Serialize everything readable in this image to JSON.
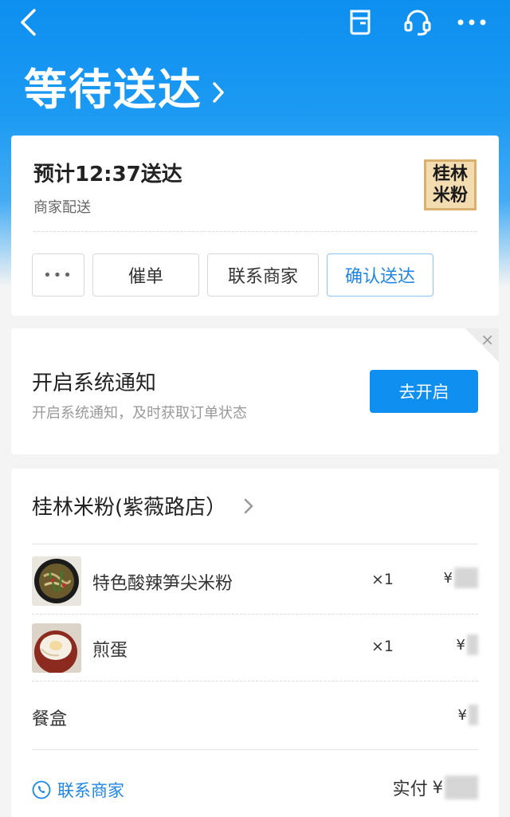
{
  "header": {
    "title": "等待送达",
    "icons": [
      "back-arrow-icon",
      "order-box-icon",
      "headset-icon",
      "more-icon"
    ]
  },
  "status_card": {
    "eta_text": "预计12:37送达",
    "delivery_by": "商家配送",
    "logo_text_line1": "桂林",
    "logo_text_line2": "米粉",
    "buttons": {
      "more": "•••",
      "urge": "催单",
      "contact_shop": "联系商家",
      "confirm": "确认送达"
    }
  },
  "notification_card": {
    "title": "开启系统通知",
    "subtitle": "开启系统通知，及时获取订单状态",
    "enable_label": "去开启",
    "close_glyph": "×"
  },
  "order_card": {
    "shop_name": "桂林米粉(紫薇路店）",
    "items": [
      {
        "name": "特色酸辣笋尖米粉",
        "qty": "×1",
        "price_symbol": "¥"
      },
      {
        "name": "煎蛋",
        "qty": "×1",
        "price_symbol": "¥"
      }
    ],
    "box_fee": {
      "label": "餐盒",
      "price_symbol": "¥"
    },
    "contact_label": "联系商家",
    "paid_label": "实付",
    "paid_symbol": "¥"
  },
  "colors": {
    "brand_blue": "#0f8ff0",
    "link_blue": "#1f86e6"
  }
}
